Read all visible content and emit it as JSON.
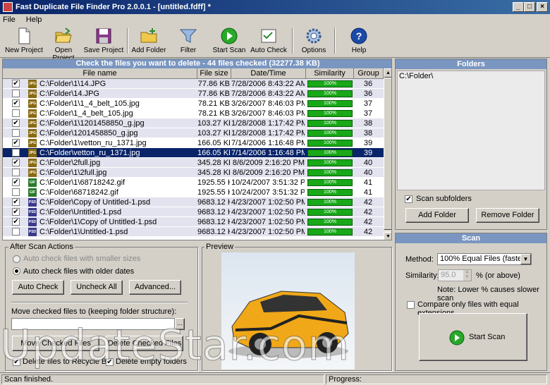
{
  "window": {
    "title": "Fast Duplicate File Finder Pro 2.0.0.1 - [untitled.fdff] *"
  },
  "menu": [
    "File",
    "Help"
  ],
  "toolbar": [
    {
      "label": "New Project",
      "icon": "new-project-icon"
    },
    {
      "label": "Open Project",
      "icon": "open-project-icon"
    },
    {
      "label": "Save Project",
      "icon": "save-project-icon"
    },
    {
      "label": "Add Folder",
      "icon": "add-folder-icon"
    },
    {
      "label": "Filter",
      "icon": "filter-icon"
    },
    {
      "label": "Start Scan",
      "icon": "start-scan-icon"
    },
    {
      "label": "Auto Check",
      "icon": "auto-check-icon"
    },
    {
      "label": "Options",
      "icon": "options-icon"
    },
    {
      "label": "Help",
      "icon": "help-icon"
    }
  ],
  "list": {
    "header": "Check the files you want to delete - 44 files checked (32277.38 KB)",
    "columns": [
      "File name",
      "File size",
      "Date/Time",
      "Similarity",
      "Group"
    ],
    "rows": [
      {
        "checked": true,
        "type": "JPG",
        "name": "C:\\Folder\\1\\14.JPG",
        "size": "77.86 KB",
        "date": "7/28/2006 8:43:22 AM",
        "sim": "100%",
        "group": "36"
      },
      {
        "checked": false,
        "type": "JPG",
        "name": "C:\\Folder\\14.JPG",
        "size": "77.86 KB",
        "date": "7/28/2006 8:43:22 AM",
        "sim": "100%",
        "group": "36"
      },
      {
        "checked": true,
        "type": "JPG",
        "name": "C:\\Folder\\1\\1_4_belt_105.jpg",
        "size": "78.21 KB",
        "date": "3/26/2007 8:46:03 PM",
        "sim": "100%",
        "group": "37"
      },
      {
        "checked": false,
        "type": "JPG",
        "name": "C:\\Folder\\1_4_belt_105.jpg",
        "size": "78.21 KB",
        "date": "3/26/2007 8:46:03 PM",
        "sim": "100%",
        "group": "37"
      },
      {
        "checked": true,
        "type": "JPG",
        "name": "C:\\Folder\\1\\1201458850_g.jpg",
        "size": "103.27 KB",
        "date": "1/28/2008 1:17:42 PM",
        "sim": "100%",
        "group": "38"
      },
      {
        "checked": false,
        "type": "JPG",
        "name": "C:\\Folder\\1201458850_g.jpg",
        "size": "103.27 KB",
        "date": "1/28/2008 1:17:42 PM",
        "sim": "100%",
        "group": "38"
      },
      {
        "checked": true,
        "type": "JPG",
        "name": "C:\\Folder\\1\\vetton_ru_1371.jpg",
        "size": "166.05 KB",
        "date": "7/14/2006 1:16:48 PM",
        "sim": "100%",
        "group": "39"
      },
      {
        "checked": false,
        "type": "JPG",
        "name": "C:\\Folder\\vetton_ru_1371.jpg",
        "size": "166.05 KB",
        "date": "7/14/2006 1:16:48 PM",
        "sim": "100%",
        "group": "39",
        "selected": true
      },
      {
        "checked": true,
        "type": "JPG",
        "name": "C:\\Folder\\2full.jpg",
        "size": "345.28 KB",
        "date": "8/6/2009 2:16:20 PM",
        "sim": "100%",
        "group": "40"
      },
      {
        "checked": false,
        "type": "JPG",
        "name": "C:\\Folder\\1\\2full.jpg",
        "size": "345.28 KB",
        "date": "8/6/2009 2:16:20 PM",
        "sim": "100%",
        "group": "40"
      },
      {
        "checked": true,
        "type": "GIF",
        "name": "C:\\Folder\\1\\68718242.gif",
        "size": "1925.55 KB",
        "date": "10/24/2007 3:51:32 PM",
        "sim": "100%",
        "group": "41"
      },
      {
        "checked": false,
        "type": "GIF",
        "name": "C:\\Folder\\68718242.gif",
        "size": "1925.55 KB",
        "date": "10/24/2007 3:51:32 PM",
        "sim": "100%",
        "group": "41"
      },
      {
        "checked": true,
        "type": "PSD",
        "name": "C:\\Folder\\Copy of Untitled-1.psd",
        "size": "9683.12 KB",
        "date": "4/23/2007 1:02:50 PM",
        "sim": "100%",
        "group": "42"
      },
      {
        "checked": true,
        "type": "PSD",
        "name": "C:\\Folder\\Untitled-1.psd",
        "size": "9683.12 KB",
        "date": "4/23/2007 1:02:50 PM",
        "sim": "100%",
        "group": "42"
      },
      {
        "checked": true,
        "type": "PSD",
        "name": "C:\\Folder\\1\\Copy of Untitled-1.psd",
        "size": "9683.12 KB",
        "date": "4/23/2007 1:02:50 PM",
        "sim": "100%",
        "group": "42"
      },
      {
        "checked": false,
        "type": "PSD",
        "name": "C:\\Folder\\1\\Untitled-1.psd",
        "size": "9683.12 KB",
        "date": "4/23/2007 1:02:50 PM",
        "sim": "100%",
        "group": "42"
      }
    ]
  },
  "after_scan": {
    "title": "After Scan Actions",
    "radio1": "Auto check files with smaller sizes",
    "radio2": "Auto check files with older dates",
    "auto_check": "Auto Check",
    "uncheck_all": "Uncheck All",
    "advanced": "Advanced...",
    "move_label": "Move checked files to (keeping folder structure):",
    "move_value": "",
    "browse": "...",
    "move_btn": "Move Checked Files",
    "delete_btn": "Delete Checked Files",
    "recycle": "Delete files to Recycle Bin",
    "empty_folders": "Delete empty folders"
  },
  "preview": {
    "title": "Preview"
  },
  "folders": {
    "title": "Folders",
    "items": [
      "C:\\Folder\\"
    ],
    "scan_sub": "Scan subfolders",
    "add": "Add Folder",
    "remove": "Remove Folder"
  },
  "scan": {
    "title": "Scan",
    "method_label": "Method:",
    "method_value": "100% Equal Files (faster)",
    "similarity_label": "Similarity:",
    "similarity_value": "95.0",
    "similarity_unit": "% (or above)",
    "note": "Note: Lower % causes slower scan",
    "compare_ext": "Compare only files with equal extensions",
    "start": "Start Scan"
  },
  "status": {
    "text": "Scan finished.",
    "progress_label": "Progress:"
  },
  "watermark": "UpdateStar.com"
}
